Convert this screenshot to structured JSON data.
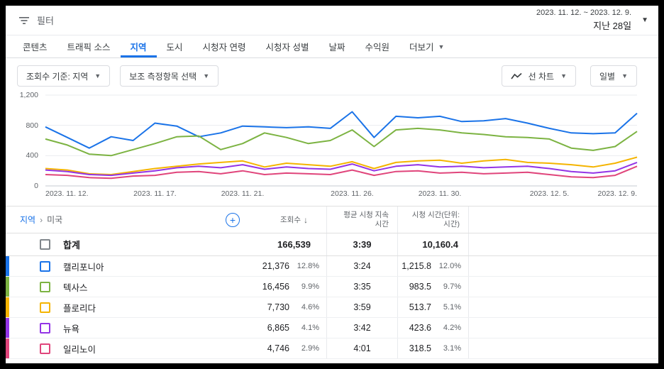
{
  "icons": {
    "plus": "+",
    "caret_down": "▼",
    "sort_desc": "↓",
    "breadcrumb_sep": "›"
  },
  "header": {
    "filter_label": "필터",
    "date_range": "2023. 11. 12. ~ 2023. 12. 9.",
    "date_preset": "지난 28일"
  },
  "tabs": {
    "content": "콘텐츠",
    "traffic_source": "트래픽 소스",
    "geography": "지역",
    "cities": "도시",
    "viewer_age": "시청자 연령",
    "viewer_gender": "시청자 성별",
    "date": "날짜",
    "revenue_source": "수익원",
    "more": "더보기"
  },
  "controls": {
    "primary_dimension": "조회수 기준: 지역",
    "secondary_metric": "보조 측정항목 선택",
    "chart_type": "선 차트",
    "interval": "일별"
  },
  "chart_data": {
    "type": "line",
    "ylim": [
      0,
      1200
    ],
    "days": 28,
    "yticks": [
      {
        "value": 0,
        "label": "0"
      },
      {
        "value": 400,
        "label": "400"
      },
      {
        "value": 800,
        "label": "800"
      },
      {
        "value": 1200,
        "label": "1,200"
      }
    ],
    "x_ticks": [
      {
        "day": 0,
        "label": "2023. 11. 12."
      },
      {
        "day": 5,
        "label": "2023. 11. 17."
      },
      {
        "day": 9,
        "label": "2023. 11. 21."
      },
      {
        "day": 14,
        "label": "2023. 11. 26."
      },
      {
        "day": 18,
        "label": "2023. 11. 30."
      },
      {
        "day": 23,
        "label": "2023. 12. 5."
      },
      {
        "day": 27,
        "label": "2023. 12. 9."
      }
    ],
    "series": [
      {
        "name": "캘리포니아",
        "color": "#1a73e8",
        "values": [
          780,
          640,
          500,
          650,
          600,
          830,
          790,
          650,
          700,
          790,
          780,
          770,
          780,
          760,
          980,
          640,
          920,
          900,
          920,
          850,
          860,
          890,
          830,
          760,
          700,
          690,
          700,
          960
        ]
      },
      {
        "name": "텍사스",
        "color": "#7cb342",
        "values": [
          620,
          540,
          420,
          400,
          480,
          560,
          650,
          660,
          480,
          560,
          700,
          640,
          560,
          600,
          740,
          520,
          740,
          760,
          740,
          700,
          680,
          650,
          640,
          620,
          500,
          470,
          520,
          720
        ]
      },
      {
        "name": "플로리다",
        "color": "#f4b400",
        "values": [
          230,
          210,
          160,
          150,
          190,
          230,
          260,
          290,
          310,
          330,
          250,
          300,
          280,
          260,
          320,
          230,
          310,
          330,
          340,
          300,
          330,
          350,
          310,
          300,
          280,
          250,
          300,
          380
        ]
      },
      {
        "name": "뉴욕",
        "color": "#9334e6",
        "values": [
          210,
          190,
          150,
          140,
          170,
          200,
          240,
          260,
          240,
          280,
          220,
          250,
          230,
          220,
          290,
          200,
          260,
          280,
          250,
          260,
          240,
          250,
          260,
          230,
          190,
          170,
          200,
          310
        ]
      },
      {
        "name": "일리노이",
        "color": "#e0457b",
        "values": [
          150,
          140,
          110,
          100,
          130,
          140,
          180,
          190,
          160,
          200,
          150,
          170,
          160,
          150,
          210,
          140,
          190,
          200,
          170,
          180,
          160,
          170,
          180,
          150,
          120,
          110,
          140,
          260
        ]
      }
    ]
  },
  "table": {
    "breadcrumb": {
      "root": "지역",
      "current": "미국"
    },
    "columns": {
      "views": "조회수",
      "avg_view_duration": "평균 시청 지속 시간",
      "watch_time": "시청 시간(단위: 시간)"
    },
    "total": {
      "label": "합계",
      "views": "166,539",
      "avg": "3:39",
      "watch": "10,160.4"
    },
    "rows": [
      {
        "label": "캘리포니아",
        "views": "21,376",
        "views_pct": "12.8%",
        "avg": "3:24",
        "watch": "1,215.8",
        "watch_pct": "12.0%"
      },
      {
        "label": "텍사스",
        "views": "16,456",
        "views_pct": "9.9%",
        "avg": "3:35",
        "watch": "983.5",
        "watch_pct": "9.7%"
      },
      {
        "label": "플로리다",
        "views": "7,730",
        "views_pct": "4.6%",
        "avg": "3:59",
        "watch": "513.7",
        "watch_pct": "5.1%"
      },
      {
        "label": "뉴욕",
        "views": "6,865",
        "views_pct": "4.1%",
        "avg": "3:42",
        "watch": "423.6",
        "watch_pct": "4.2%"
      },
      {
        "label": "일리노이",
        "views": "4,746",
        "views_pct": "2.9%",
        "avg": "4:01",
        "watch": "318.5",
        "watch_pct": "3.1%"
      }
    ]
  }
}
